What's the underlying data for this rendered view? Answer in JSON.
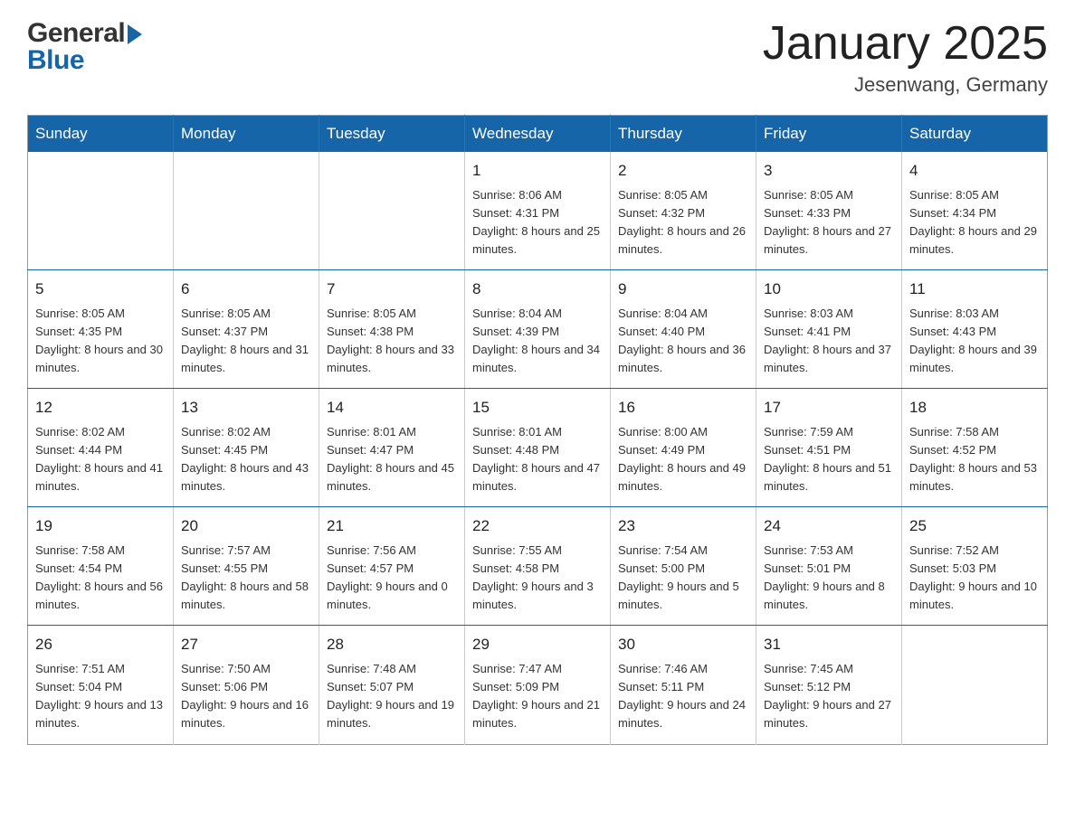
{
  "header": {
    "logo_general": "General",
    "logo_blue": "Blue",
    "month_title": "January 2025",
    "location": "Jesenwang, Germany"
  },
  "weekdays": [
    "Sunday",
    "Monday",
    "Tuesday",
    "Wednesday",
    "Thursday",
    "Friday",
    "Saturday"
  ],
  "weeks": [
    [
      {
        "day": "",
        "sunrise": "",
        "sunset": "",
        "daylight": ""
      },
      {
        "day": "",
        "sunrise": "",
        "sunset": "",
        "daylight": ""
      },
      {
        "day": "",
        "sunrise": "",
        "sunset": "",
        "daylight": ""
      },
      {
        "day": "1",
        "sunrise": "Sunrise: 8:06 AM",
        "sunset": "Sunset: 4:31 PM",
        "daylight": "Daylight: 8 hours and 25 minutes."
      },
      {
        "day": "2",
        "sunrise": "Sunrise: 8:05 AM",
        "sunset": "Sunset: 4:32 PM",
        "daylight": "Daylight: 8 hours and 26 minutes."
      },
      {
        "day": "3",
        "sunrise": "Sunrise: 8:05 AM",
        "sunset": "Sunset: 4:33 PM",
        "daylight": "Daylight: 8 hours and 27 minutes."
      },
      {
        "day": "4",
        "sunrise": "Sunrise: 8:05 AM",
        "sunset": "Sunset: 4:34 PM",
        "daylight": "Daylight: 8 hours and 29 minutes."
      }
    ],
    [
      {
        "day": "5",
        "sunrise": "Sunrise: 8:05 AM",
        "sunset": "Sunset: 4:35 PM",
        "daylight": "Daylight: 8 hours and 30 minutes."
      },
      {
        "day": "6",
        "sunrise": "Sunrise: 8:05 AM",
        "sunset": "Sunset: 4:37 PM",
        "daylight": "Daylight: 8 hours and 31 minutes."
      },
      {
        "day": "7",
        "sunrise": "Sunrise: 8:05 AM",
        "sunset": "Sunset: 4:38 PM",
        "daylight": "Daylight: 8 hours and 33 minutes."
      },
      {
        "day": "8",
        "sunrise": "Sunrise: 8:04 AM",
        "sunset": "Sunset: 4:39 PM",
        "daylight": "Daylight: 8 hours and 34 minutes."
      },
      {
        "day": "9",
        "sunrise": "Sunrise: 8:04 AM",
        "sunset": "Sunset: 4:40 PM",
        "daylight": "Daylight: 8 hours and 36 minutes."
      },
      {
        "day": "10",
        "sunrise": "Sunrise: 8:03 AM",
        "sunset": "Sunset: 4:41 PM",
        "daylight": "Daylight: 8 hours and 37 minutes."
      },
      {
        "day": "11",
        "sunrise": "Sunrise: 8:03 AM",
        "sunset": "Sunset: 4:43 PM",
        "daylight": "Daylight: 8 hours and 39 minutes."
      }
    ],
    [
      {
        "day": "12",
        "sunrise": "Sunrise: 8:02 AM",
        "sunset": "Sunset: 4:44 PM",
        "daylight": "Daylight: 8 hours and 41 minutes."
      },
      {
        "day": "13",
        "sunrise": "Sunrise: 8:02 AM",
        "sunset": "Sunset: 4:45 PM",
        "daylight": "Daylight: 8 hours and 43 minutes."
      },
      {
        "day": "14",
        "sunrise": "Sunrise: 8:01 AM",
        "sunset": "Sunset: 4:47 PM",
        "daylight": "Daylight: 8 hours and 45 minutes."
      },
      {
        "day": "15",
        "sunrise": "Sunrise: 8:01 AM",
        "sunset": "Sunset: 4:48 PM",
        "daylight": "Daylight: 8 hours and 47 minutes."
      },
      {
        "day": "16",
        "sunrise": "Sunrise: 8:00 AM",
        "sunset": "Sunset: 4:49 PM",
        "daylight": "Daylight: 8 hours and 49 minutes."
      },
      {
        "day": "17",
        "sunrise": "Sunrise: 7:59 AM",
        "sunset": "Sunset: 4:51 PM",
        "daylight": "Daylight: 8 hours and 51 minutes."
      },
      {
        "day": "18",
        "sunrise": "Sunrise: 7:58 AM",
        "sunset": "Sunset: 4:52 PM",
        "daylight": "Daylight: 8 hours and 53 minutes."
      }
    ],
    [
      {
        "day": "19",
        "sunrise": "Sunrise: 7:58 AM",
        "sunset": "Sunset: 4:54 PM",
        "daylight": "Daylight: 8 hours and 56 minutes."
      },
      {
        "day": "20",
        "sunrise": "Sunrise: 7:57 AM",
        "sunset": "Sunset: 4:55 PM",
        "daylight": "Daylight: 8 hours and 58 minutes."
      },
      {
        "day": "21",
        "sunrise": "Sunrise: 7:56 AM",
        "sunset": "Sunset: 4:57 PM",
        "daylight": "Daylight: 9 hours and 0 minutes."
      },
      {
        "day": "22",
        "sunrise": "Sunrise: 7:55 AM",
        "sunset": "Sunset: 4:58 PM",
        "daylight": "Daylight: 9 hours and 3 minutes."
      },
      {
        "day": "23",
        "sunrise": "Sunrise: 7:54 AM",
        "sunset": "Sunset: 5:00 PM",
        "daylight": "Daylight: 9 hours and 5 minutes."
      },
      {
        "day": "24",
        "sunrise": "Sunrise: 7:53 AM",
        "sunset": "Sunset: 5:01 PM",
        "daylight": "Daylight: 9 hours and 8 minutes."
      },
      {
        "day": "25",
        "sunrise": "Sunrise: 7:52 AM",
        "sunset": "Sunset: 5:03 PM",
        "daylight": "Daylight: 9 hours and 10 minutes."
      }
    ],
    [
      {
        "day": "26",
        "sunrise": "Sunrise: 7:51 AM",
        "sunset": "Sunset: 5:04 PM",
        "daylight": "Daylight: 9 hours and 13 minutes."
      },
      {
        "day": "27",
        "sunrise": "Sunrise: 7:50 AM",
        "sunset": "Sunset: 5:06 PM",
        "daylight": "Daylight: 9 hours and 16 minutes."
      },
      {
        "day": "28",
        "sunrise": "Sunrise: 7:48 AM",
        "sunset": "Sunset: 5:07 PM",
        "daylight": "Daylight: 9 hours and 19 minutes."
      },
      {
        "day": "29",
        "sunrise": "Sunrise: 7:47 AM",
        "sunset": "Sunset: 5:09 PM",
        "daylight": "Daylight: 9 hours and 21 minutes."
      },
      {
        "day": "30",
        "sunrise": "Sunrise: 7:46 AM",
        "sunset": "Sunset: 5:11 PM",
        "daylight": "Daylight: 9 hours and 24 minutes."
      },
      {
        "day": "31",
        "sunrise": "Sunrise: 7:45 AM",
        "sunset": "Sunset: 5:12 PM",
        "daylight": "Daylight: 9 hours and 27 minutes."
      },
      {
        "day": "",
        "sunrise": "",
        "sunset": "",
        "daylight": ""
      }
    ]
  ]
}
